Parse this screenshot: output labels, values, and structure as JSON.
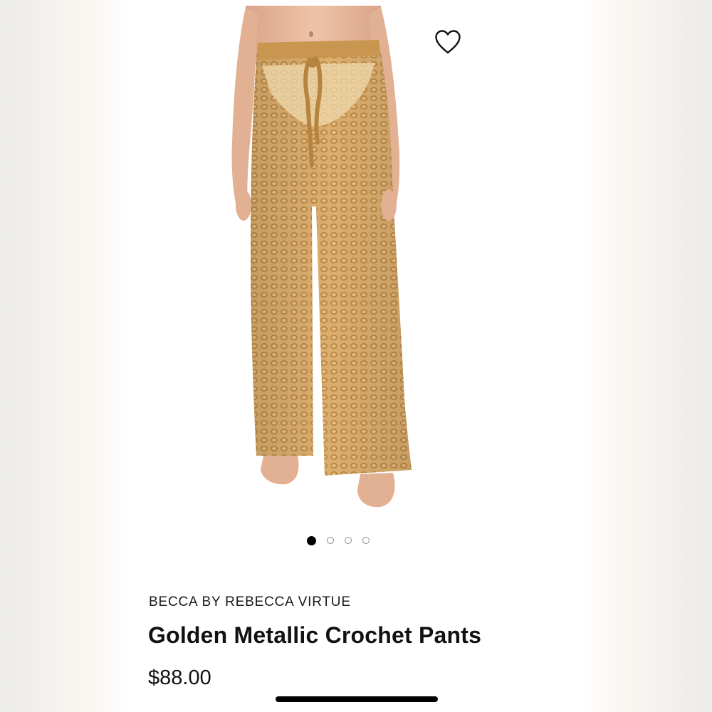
{
  "product": {
    "brand": "BECCA BY REBECCA VIRTUE",
    "title": "Golden Metallic Crochet Pants",
    "price": "$88.00",
    "image_subject": "model wearing golden metallic crochet wide-leg pants",
    "favorite_icon": "heart-outline-icon"
  },
  "carousel": {
    "total": 4,
    "active_index": 0
  },
  "colors": {
    "fabric": "#d9ab6a",
    "skin": "#e8b79c",
    "active_dot": "#000000",
    "inactive_dot_border": "#8a8a8a"
  }
}
